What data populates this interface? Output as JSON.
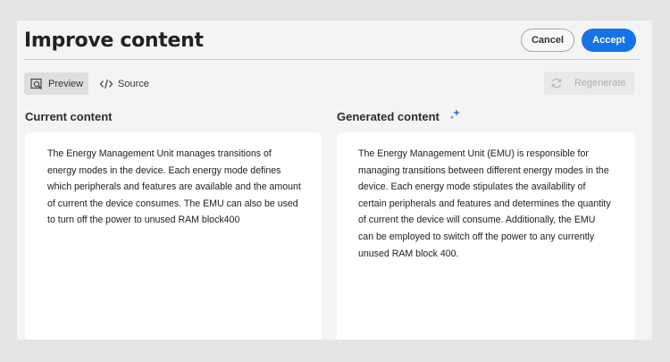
{
  "header": {
    "title": "Improve content",
    "cancel_label": "Cancel",
    "accept_label": "Accept"
  },
  "toolbar": {
    "preview_label": "Preview",
    "source_label": "Source",
    "regenerate_label": "Regenerate",
    "preview_icon": "preview-icon",
    "source_icon": "code-icon",
    "regenerate_icon": "refresh-icon"
  },
  "current": {
    "heading": "Current content",
    "text": "The Energy Management Unit manages transitions of energy modes in the device. Each energy mode defines which peripherals and features are available and the amount of current the device consumes. The EMU can also be used to turn off the power to unused RAM block400"
  },
  "generated": {
    "heading": "Generated content",
    "heading_icon": "sparkle-icon",
    "text": "The Energy Management Unit (EMU) is responsible for managing transitions between different energy modes in the device. Each energy mode stipulates the availability of certain peripherals and features and determines the quantity of current the device will consume. Additionally, the EMU can be employed to switch off the power to any currently unused RAM block 400."
  },
  "colors": {
    "accent": "#1473e6",
    "sparkle_blue": "#2d6fe0",
    "sparkle_purple": "#8a5cf0"
  }
}
